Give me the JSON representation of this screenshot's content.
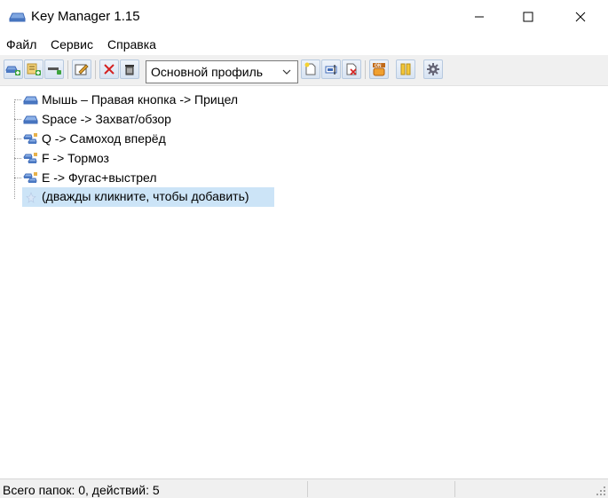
{
  "window": {
    "title": "Key Manager 1.15",
    "icon": "key-manager-icon",
    "controls": [
      "minimize",
      "maximize",
      "close"
    ]
  },
  "menu": {
    "items": [
      {
        "label": "Файл"
      },
      {
        "label": "Сервис"
      },
      {
        "label": "Справка"
      }
    ]
  },
  "toolbar": {
    "buttons": [
      {
        "name": "add-action",
        "icon": "add-key-icon"
      },
      {
        "name": "add-folder",
        "icon": "add-folder-icon"
      },
      {
        "name": "remove",
        "icon": "remove-icon"
      },
      {
        "name": "edit",
        "icon": "edit-icon"
      },
      {
        "name": "delete",
        "icon": "delete-x-icon"
      },
      {
        "name": "clear",
        "icon": "trash-icon"
      },
      {
        "name": "new-profile",
        "icon": "new-document-icon"
      },
      {
        "name": "rename-profile",
        "icon": "rename-icon"
      },
      {
        "name": "delete-profile",
        "icon": "delete-document-icon"
      },
      {
        "name": "on-off",
        "icon": "on-off-icon"
      },
      {
        "name": "pause",
        "icon": "pause-icon"
      },
      {
        "name": "settings",
        "icon": "gear-icon"
      }
    ],
    "profile": {
      "selected": "Основной профиль"
    }
  },
  "tree": {
    "items": [
      {
        "label": "Мышь – Правая кнопка -> Прицел",
        "icon": "key-icon"
      },
      {
        "label": "Space -> Захват/обзор",
        "icon": "key-icon"
      },
      {
        "label": "Q -> Самоход вперёд",
        "icon": "key-chain-icon"
      },
      {
        "label": "F -> Тормоз",
        "icon": "key-chain-icon"
      },
      {
        "label": "E -> Фугас+выстрел",
        "icon": "key-chain-icon"
      }
    ],
    "add_hint": "(дважды кликните, чтобы добавить)"
  },
  "status": {
    "text": "Всего папок: 0, действий: 5"
  },
  "colors": {
    "selection": "#cce4f7",
    "toolbar_bg": "#f0f0f0",
    "key_blue": "#4a78c2"
  }
}
